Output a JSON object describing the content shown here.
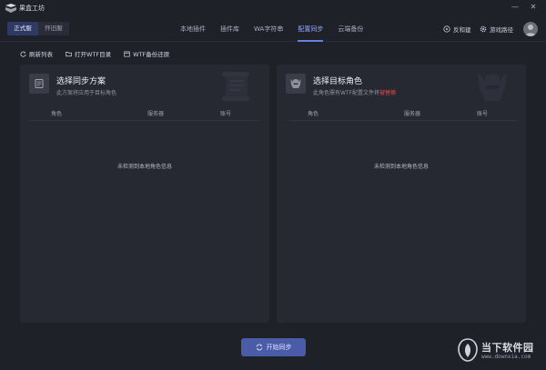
{
  "app": {
    "title": "果盒工坊"
  },
  "window": {
    "minimize": "—",
    "close": "✕"
  },
  "edition": {
    "items": [
      {
        "label": "正式服",
        "active": true
      },
      {
        "label": "怀旧服",
        "active": false
      }
    ]
  },
  "nav": {
    "tabs": [
      {
        "label": "本地插件",
        "active": false
      },
      {
        "label": "插件库",
        "active": false
      },
      {
        "label": "WA字符串",
        "active": false
      },
      {
        "label": "配置同步",
        "active": true
      },
      {
        "label": "云端备份",
        "active": false
      }
    ]
  },
  "header_actions": {
    "feedback": "反和建",
    "game_path": "游戏路径"
  },
  "toolbar": {
    "refresh": "刷新列表",
    "open_wtf": "打开WTF目录",
    "wtf_restore": "WTF备份还原"
  },
  "left_panel": {
    "title": "选择同步方案",
    "subtitle": "此方案将应用于目标角色",
    "columns": [
      "角色",
      "服务器",
      "账号"
    ],
    "empty": "未检测到本地角色信息"
  },
  "right_panel": {
    "title": "选择目标角色",
    "subtitle_prefix": "此角色需有WTF配置文件将",
    "subtitle_warn": "被替换",
    "columns": [
      "角色",
      "服务器",
      "账号"
    ],
    "empty": "未检测到本地角色信息"
  },
  "start_button": {
    "label": "开始同步"
  },
  "brand": {
    "name": "当下软件园",
    "url": "www.downxia.com"
  },
  "colors": {
    "accent": "#6a7fe6",
    "warn": "#e64a4a",
    "button": "#4a5ba8",
    "background": "#1f2129"
  }
}
